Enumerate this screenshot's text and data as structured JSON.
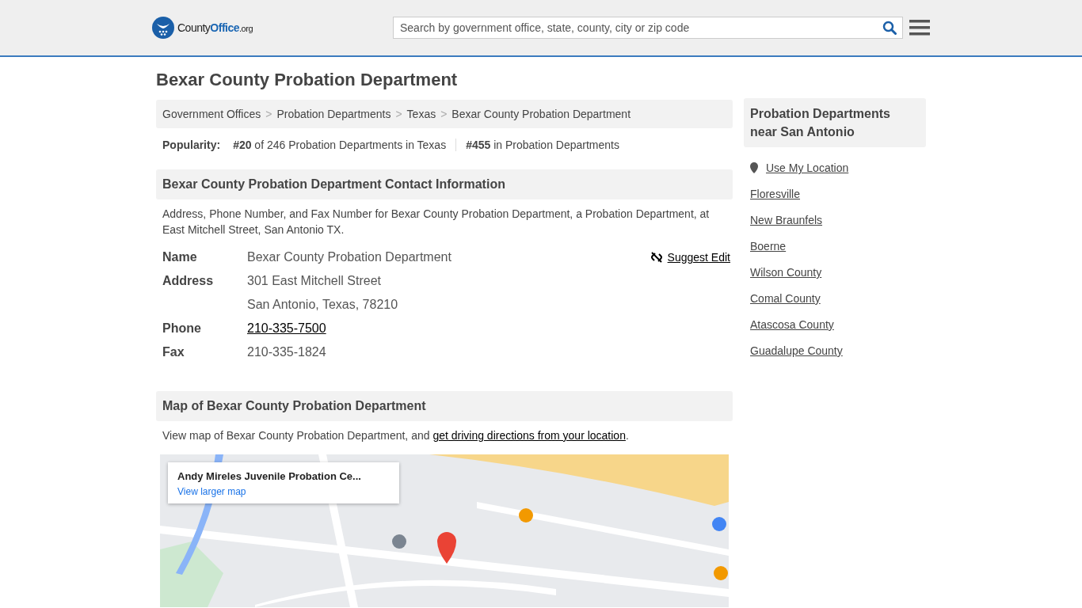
{
  "header": {
    "logo": [
      {
        "text": "County",
        "kind": "plain"
      },
      {
        "text": "Office",
        "kind": "accent"
      },
      {
        "text": ".org",
        "kind": "small"
      }
    ],
    "search": {
      "placeholder": "Search by government office, state, county, city or zip code"
    }
  },
  "title": "Bexar County Probation Department",
  "breadcrumbs": [
    "Government Offices",
    "Probation Departments",
    "Texas",
    "Bexar County Probation Department"
  ],
  "breadcrumb_separator": ">",
  "popularity": {
    "label": "Popularity:",
    "items": [
      "**#20** of 246 Probation Departments in Texas",
      "**#455** in Probation Departments"
    ]
  },
  "contact": {
    "heading": "Bexar County Probation Department Contact Information",
    "intro": "Address, Phone Number, and Fax Number for Bexar County Probation Department, a Probation Department, at East Mitchell Street, San Antonio TX.",
    "suggest_edit": "Suggest Edit",
    "fields": [
      {
        "label": "Name",
        "lines": [
          "Bexar County Probation Department"
        ],
        "kind": "text"
      },
      {
        "label": "Address",
        "lines": [
          "301 East Mitchell Street",
          "San Antonio, Texas, 78210"
        ],
        "kind": "text"
      },
      {
        "label": "Phone",
        "lines": [
          "210-335-7500"
        ],
        "kind": "link"
      },
      {
        "label": "Fax",
        "lines": [
          "210-335-1824"
        ],
        "kind": "text"
      }
    ]
  },
  "map": {
    "heading": "Map of Bexar County Probation Department",
    "intro_prefix": "View map of Bexar County Probation Department, and ",
    "intro_link": "get driving directions from your location",
    "intro_suffix": ".",
    "card_title": "Andy Mireles Juvenile Probation Ce...",
    "card_link": "View larger map",
    "kind": "picture"
  },
  "sidebar": {
    "heading": "Probation Departments near San Antonio",
    "use_location": "Use My Location",
    "links": [
      "Floresville",
      "New Braunfels",
      "Boerne",
      "Wilson County",
      "Comal County",
      "Atascosa County",
      "Guadalupe County"
    ]
  }
}
